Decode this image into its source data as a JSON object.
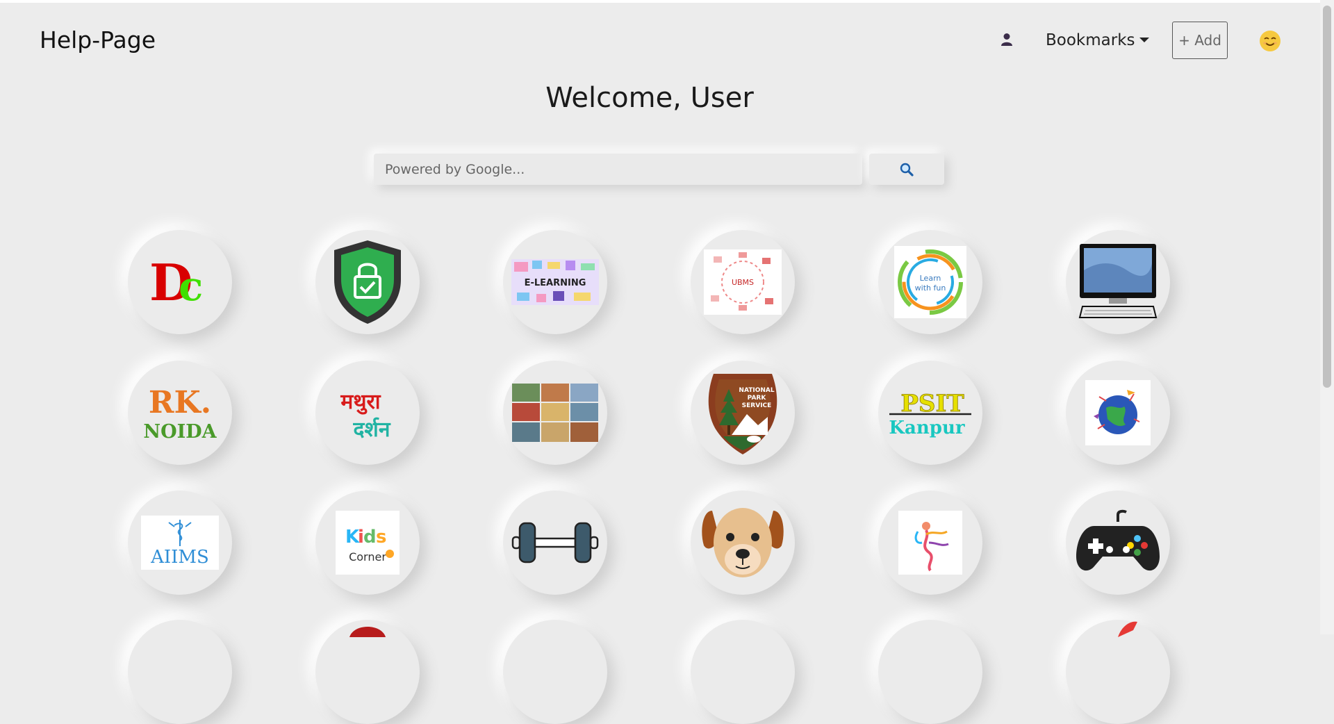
{
  "header": {
    "brand": "Help-Page",
    "bookmarks_label": "Bookmarks",
    "add_label": "+ Add"
  },
  "main": {
    "welcome": "Welcome, User",
    "search": {
      "placeholder": "Powered by Google..."
    }
  },
  "tiles": [
    {
      "name": "dc-logo",
      "text": "Dc"
    },
    {
      "name": "security-shield-icon"
    },
    {
      "name": "e-learning-logo",
      "text": "E-LEARNING"
    },
    {
      "name": "ubms-logo",
      "text": "UBMS"
    },
    {
      "name": "learn-with-fun-logo",
      "text": "Learn with fun"
    },
    {
      "name": "computer-icon"
    },
    {
      "name": "rk-noida-logo",
      "text_top": "RK.",
      "text_bottom": "NOIDA"
    },
    {
      "name": "mathura-darshan-logo",
      "text_top": "मथुरा",
      "text_bottom": "दर्शन"
    },
    {
      "name": "tourism-collage-icon"
    },
    {
      "name": "national-park-service-logo",
      "text": "NATIONAL PARK SERVICE"
    },
    {
      "name": "psit-kanpur-logo",
      "text_top": "PSIT",
      "text_bottom": "Kanpur"
    },
    {
      "name": "world-travel-icon"
    },
    {
      "name": "aiims-logo",
      "text": "AIIMS"
    },
    {
      "name": "kids-corner-logo",
      "text_top": "Kids",
      "text_bottom": "Corner"
    },
    {
      "name": "dumbbell-icon"
    },
    {
      "name": "dog-face-icon"
    },
    {
      "name": "dance-icon"
    },
    {
      "name": "game-controller-icon"
    }
  ]
}
